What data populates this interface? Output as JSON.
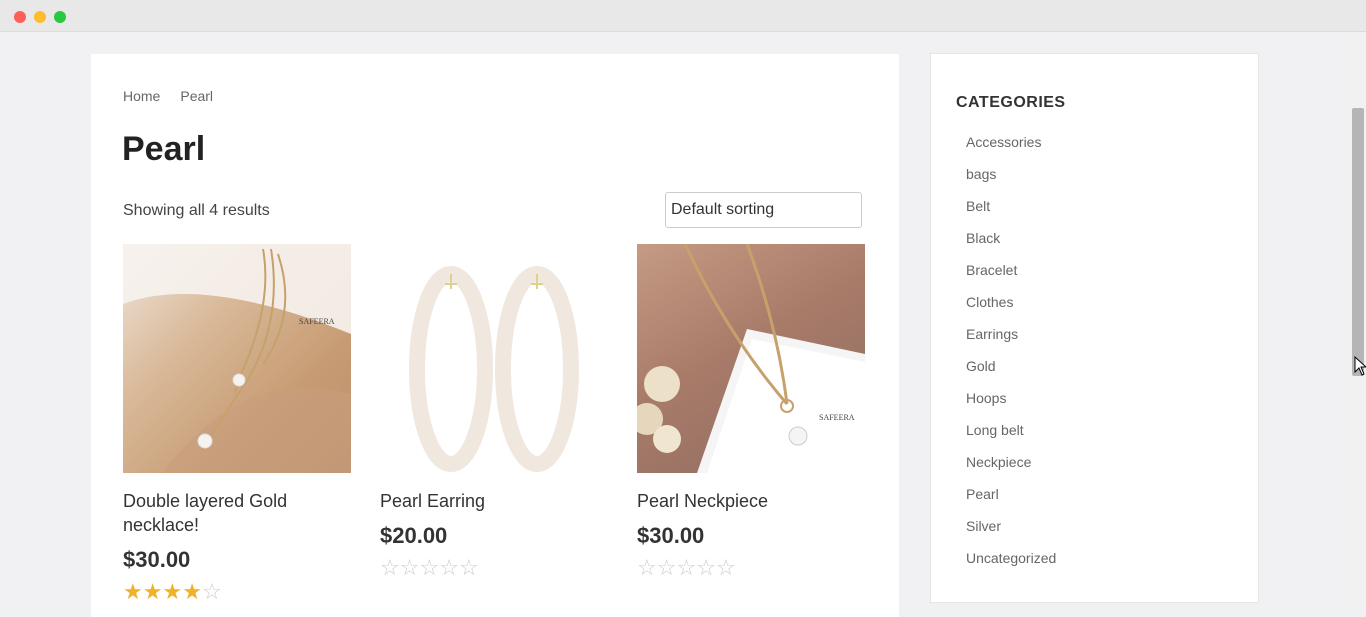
{
  "breadcrumb": {
    "home": "Home",
    "current": "Pearl"
  },
  "page": {
    "title": "Pearl",
    "result_count": "Showing all 4 results",
    "sort_label": "Default sorting"
  },
  "products": [
    {
      "name": "Double layered Gold necklace!",
      "price": "$30.00",
      "rating": 4,
      "watermark": "SAFEERA"
    },
    {
      "name": "Pearl Earring",
      "price": "$20.00",
      "rating": 0
    },
    {
      "name": "Pearl Neckpiece",
      "price": "$30.00",
      "rating": 0,
      "watermark": "SAFEERA"
    }
  ],
  "sidebar": {
    "title": "CATEGORIES",
    "categories": [
      "Accessories",
      "bags",
      "Belt",
      "Black",
      "Bracelet",
      "Clothes",
      "Earrings",
      "Gold",
      "Hoops",
      "Long belt",
      "Neckpiece",
      "Pearl",
      "Silver",
      "Uncategorized"
    ]
  },
  "colors": {
    "star_filled": "#f0b22a",
    "star_empty": "#cccccc"
  }
}
